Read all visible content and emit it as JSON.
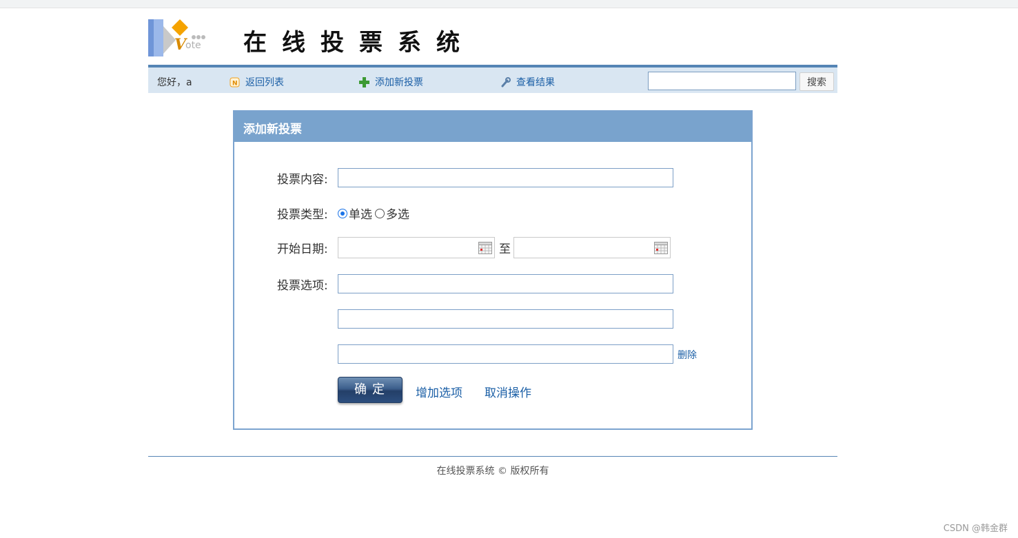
{
  "header": {
    "logo_text": "Vote",
    "site_title": "在线投票系统"
  },
  "nav": {
    "greeting": "您好，a",
    "back_label": "返回列表",
    "add_label": "添加新投票",
    "result_label": "查看结果",
    "search_value": "",
    "search_button": "搜索"
  },
  "panel": {
    "title": "添加新投票",
    "content_label": "投票内容:",
    "content_value": "",
    "type_label": "投票类型:",
    "type_options": [
      "单选",
      "多选"
    ],
    "type_selected": "单选",
    "date_label": "开始日期:",
    "date_sep": "至",
    "start_date": "",
    "end_date": "",
    "options_label": "投票选项:",
    "options": [
      "",
      "",
      ""
    ],
    "delete_label": "删除",
    "ok_button": "确定",
    "add_option": "增加选项",
    "cancel": "取消操作"
  },
  "footer": {
    "text": "在线投票系统 © 版权所有"
  },
  "watermark": "CSDN @韩金群",
  "colors": {
    "nav_bar": "#d9e6f2",
    "nav_border": "#5585b5",
    "panel_head": "#79a3cd",
    "link": "#1b5fa6"
  }
}
